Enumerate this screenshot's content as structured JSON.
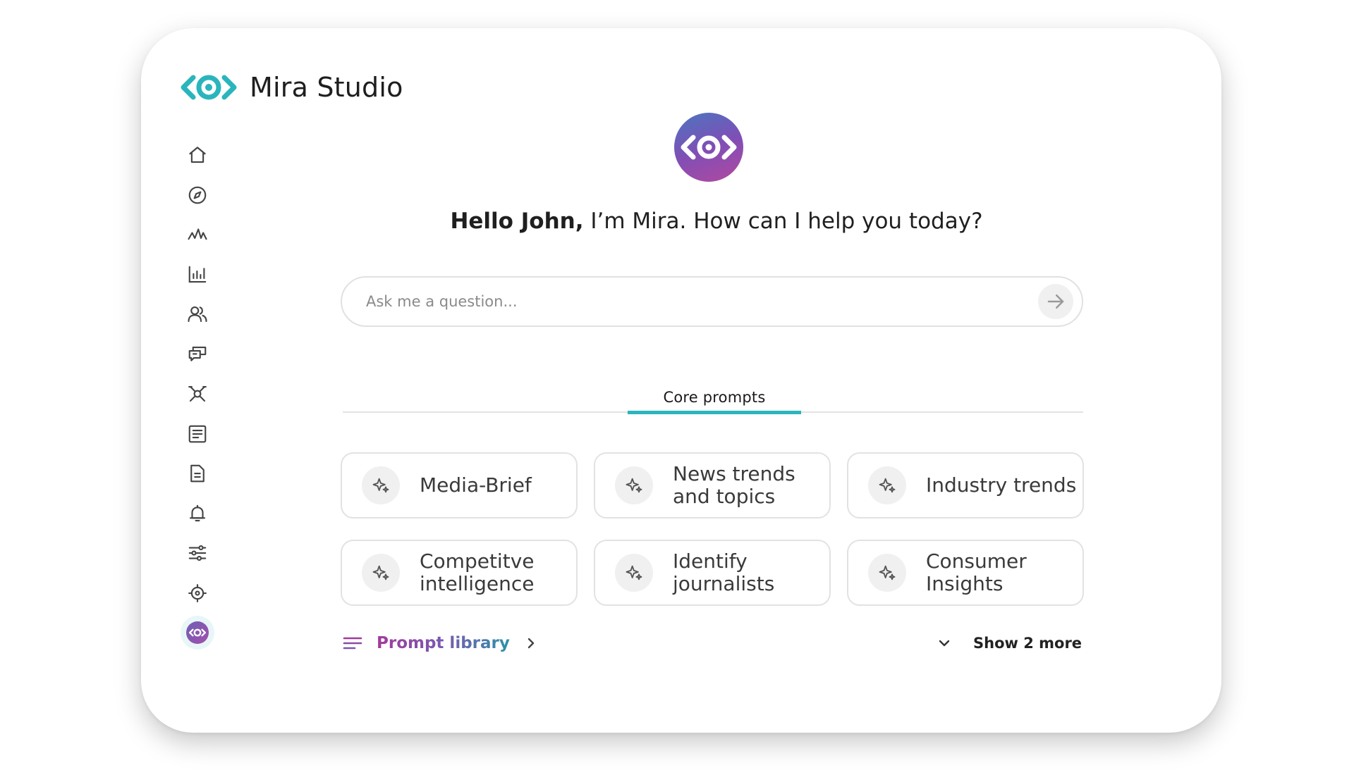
{
  "app": {
    "title": "Mira Studio"
  },
  "colors": {
    "accent": "#2ab5bd",
    "icon_gray": "#444444",
    "brand_purple": "#8a4fb0"
  },
  "sidebar": {
    "items": [
      {
        "icon": "home-icon"
      },
      {
        "icon": "compass-icon"
      },
      {
        "icon": "pulse-icon"
      },
      {
        "icon": "bar-chart-icon"
      },
      {
        "icon": "users-icon"
      },
      {
        "icon": "chat-icon"
      },
      {
        "icon": "network-icon"
      },
      {
        "icon": "newsletter-icon"
      },
      {
        "icon": "document-icon"
      },
      {
        "icon": "bell-icon"
      },
      {
        "icon": "sliders-icon"
      },
      {
        "icon": "gear-icon"
      },
      {
        "icon": "mira-logo-icon",
        "active": true
      }
    ]
  },
  "greeting": {
    "name": "Hello John,",
    "text": " I’m Mira. How can I help you today?"
  },
  "search": {
    "placeholder": "Ask me a question..."
  },
  "tabs": [
    {
      "label": "Core prompts",
      "active": true
    }
  ],
  "prompts": [
    {
      "label": "Media-Brief"
    },
    {
      "label": "News trends\nand topics"
    },
    {
      "label": "Industry trends"
    },
    {
      "label": "Competitve\nintelligence"
    },
    {
      "label": "Identify\njournalists"
    },
    {
      "label": "Consumer\nInsights"
    }
  ],
  "footer": {
    "library_label": "Prompt library",
    "show_more_label": "Show 2 more"
  }
}
